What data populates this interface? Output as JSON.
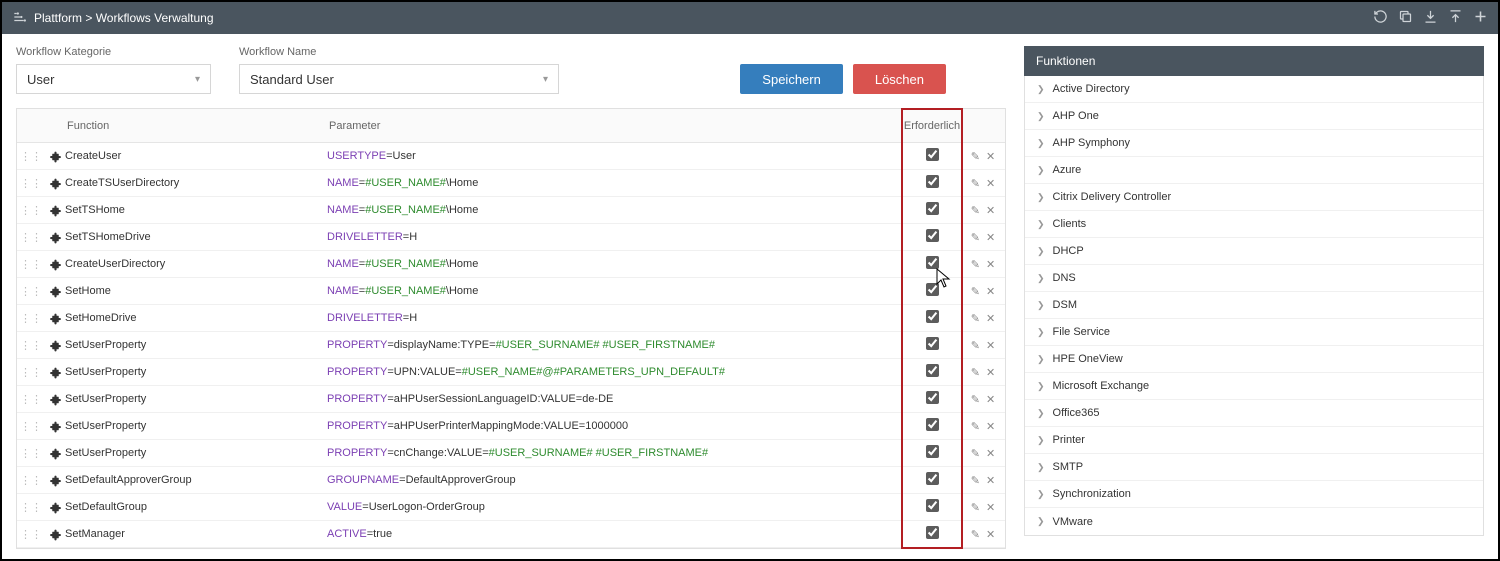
{
  "header": {
    "breadcrumb": "Plattform > Workflows Verwaltung"
  },
  "form": {
    "kat_label": "Workflow Kategorie",
    "kat_value": "User",
    "name_label": "Workflow Name",
    "name_value": "Standard User",
    "save_label": "Speichern",
    "delete_label": "Löschen"
  },
  "columns": {
    "function": "Function",
    "parameter": "Parameter",
    "required": "Erforderlich"
  },
  "rows": [
    {
      "fn": "CreateUser",
      "param": [
        [
          "k",
          "USERTYPE"
        ],
        [
          "e",
          "="
        ],
        [
          "plain",
          "User"
        ]
      ],
      "req": true
    },
    {
      "fn": "CreateTSUserDirectory",
      "param": [
        [
          "k",
          "NAME"
        ],
        [
          "e",
          "="
        ],
        [
          "v",
          "#USER_NAME#"
        ],
        [
          "plain",
          "\\Home"
        ]
      ],
      "req": true
    },
    {
      "fn": "SetTSHome",
      "param": [
        [
          "k",
          "NAME"
        ],
        [
          "e",
          "="
        ],
        [
          "v",
          "#USER_NAME#"
        ],
        [
          "plain",
          "\\Home"
        ]
      ],
      "req": true
    },
    {
      "fn": "SetTSHomeDrive",
      "param": [
        [
          "k",
          "DRIVELETTER"
        ],
        [
          "e",
          "="
        ],
        [
          "plain",
          "H"
        ]
      ],
      "req": true
    },
    {
      "fn": "CreateUserDirectory",
      "param": [
        [
          "k",
          "NAME"
        ],
        [
          "e",
          "="
        ],
        [
          "v",
          "#USER_NAME#"
        ],
        [
          "plain",
          "\\Home"
        ]
      ],
      "req": true
    },
    {
      "fn": "SetHome",
      "param": [
        [
          "k",
          "NAME"
        ],
        [
          "e",
          "="
        ],
        [
          "v",
          "#USER_NAME#"
        ],
        [
          "plain",
          "\\Home"
        ]
      ],
      "req": true
    },
    {
      "fn": "SetHomeDrive",
      "param": [
        [
          "k",
          "DRIVELETTER"
        ],
        [
          "e",
          "="
        ],
        [
          "plain",
          "H"
        ]
      ],
      "req": true
    },
    {
      "fn": "SetUserProperty",
      "param": [
        [
          "k",
          "PROPERTY"
        ],
        [
          "e",
          "="
        ],
        [
          "plain",
          "displayName:TYPE"
        ],
        [
          "e",
          "="
        ],
        [
          "v",
          "#USER_SURNAME# #USER_FIRSTNAME#"
        ]
      ],
      "req": true
    },
    {
      "fn": "SetUserProperty",
      "param": [
        [
          "k",
          "PROPERTY"
        ],
        [
          "e",
          "="
        ],
        [
          "plain",
          "UPN:VALUE"
        ],
        [
          "e",
          "="
        ],
        [
          "v",
          "#USER_NAME#@#PARAMETERS_UPN_DEFAULT#"
        ]
      ],
      "req": true
    },
    {
      "fn": "SetUserProperty",
      "param": [
        [
          "k",
          "PROPERTY"
        ],
        [
          "e",
          "="
        ],
        [
          "plain",
          "aHPUserSessionLanguageID:VALUE"
        ],
        [
          "e",
          "="
        ],
        [
          "plain",
          "de-DE"
        ]
      ],
      "req": true
    },
    {
      "fn": "SetUserProperty",
      "param": [
        [
          "k",
          "PROPERTY"
        ],
        [
          "e",
          "="
        ],
        [
          "plain",
          "aHPUserPrinterMappingMode:VALUE"
        ],
        [
          "e",
          "="
        ],
        [
          "plain",
          "1000000"
        ]
      ],
      "req": true
    },
    {
      "fn": "SetUserProperty",
      "param": [
        [
          "k",
          "PROPERTY"
        ],
        [
          "e",
          "="
        ],
        [
          "plain",
          "cnChange:VALUE"
        ],
        [
          "e",
          "="
        ],
        [
          "v",
          "#USER_SURNAME# #USER_FIRSTNAME#"
        ]
      ],
      "req": true
    },
    {
      "fn": "SetDefaultApproverGroup",
      "param": [
        [
          "k",
          "GROUPNAME"
        ],
        [
          "e",
          "="
        ],
        [
          "plain",
          "DefaultApproverGroup"
        ]
      ],
      "req": true
    },
    {
      "fn": "SetDefaultGroup",
      "param": [
        [
          "k",
          "VALUE"
        ],
        [
          "e",
          "="
        ],
        [
          "plain",
          "UserLogon-OrderGroup"
        ]
      ],
      "req": true
    },
    {
      "fn": "SetManager",
      "param": [
        [
          "k",
          "ACTIVE"
        ],
        [
          "e",
          "="
        ],
        [
          "plain",
          "true"
        ]
      ],
      "req": true
    }
  ],
  "side": {
    "title": "Funktionen",
    "items": [
      "Active Directory",
      "AHP One",
      "AHP Symphony",
      "Azure",
      "Citrix Delivery Controller",
      "Clients",
      "DHCP",
      "DNS",
      "DSM",
      "File Service",
      "HPE OneView",
      "Microsoft Exchange",
      "Office365",
      "Printer",
      "SMTP",
      "Synchronization",
      "VMware"
    ]
  }
}
